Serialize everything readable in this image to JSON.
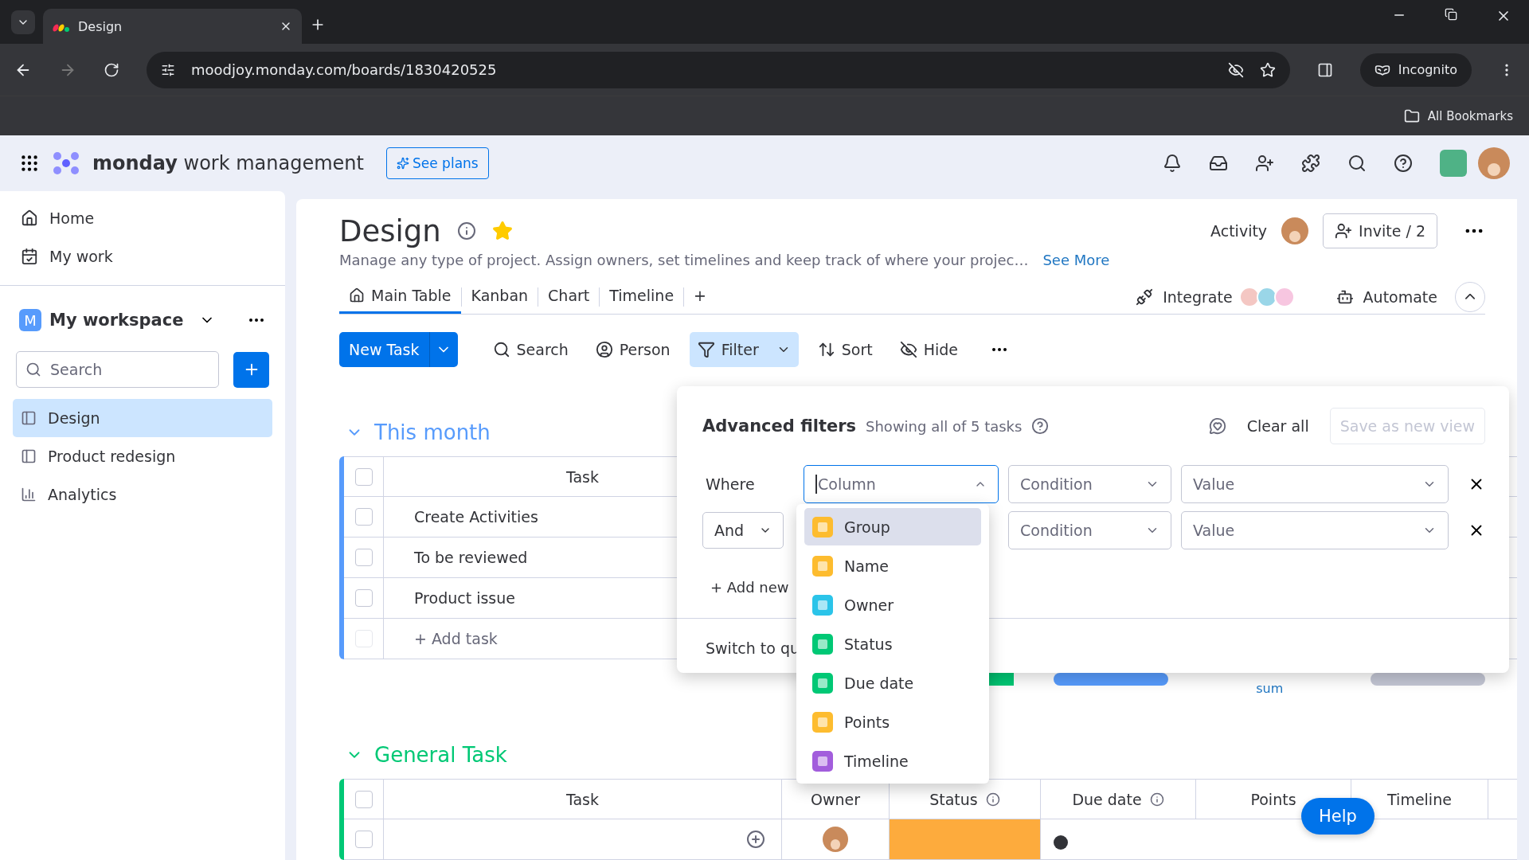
{
  "browser": {
    "tabs": [
      {
        "title": "Design",
        "selected": true
      }
    ],
    "url": "moodjoy.monday.com/boards/1830420525",
    "profile": "Incognito",
    "bookmarks_label": "All Bookmarks"
  },
  "app_header": {
    "brand": "monday",
    "product": "work management",
    "plans_button": "See plans"
  },
  "sidebar": {
    "nav": [
      {
        "label": "Home",
        "kind": "home"
      },
      {
        "label": "My work",
        "kind": "mywork"
      }
    ],
    "workspace": {
      "badge": "M",
      "name": "My workspace"
    },
    "search": {
      "placeholder": "Search"
    },
    "boards": [
      {
        "label": "Design",
        "kind": "board",
        "selected": true
      },
      {
        "label": "Product redesign",
        "kind": "board",
        "selected": false
      },
      {
        "label": "Analytics",
        "kind": "dashboard",
        "selected": false
      }
    ]
  },
  "board": {
    "title": "Design",
    "favorite": true,
    "description": "Manage any type of project. Assign owners, set timelines and keep track of where your projec…",
    "see_more": "See More",
    "activity": "Activity",
    "invite": "Invite / 2",
    "views": [
      {
        "label": "Main Table",
        "kind": "home",
        "selected": true
      },
      {
        "label": "Kanban",
        "kind": "plain",
        "selected": false
      },
      {
        "label": "Chart",
        "kind": "plain",
        "selected": false
      },
      {
        "label": "Timeline",
        "kind": "plain",
        "selected": false
      }
    ],
    "add_view": "+",
    "integrate": "Integrate",
    "automate": "Automate",
    "toolbar": {
      "new_task": "New Task",
      "items": [
        {
          "label": "Search",
          "kind": "search",
          "active": false
        },
        {
          "label": "Person",
          "kind": "person",
          "active": false
        },
        {
          "label": "Filter",
          "kind": "filter",
          "active": true
        },
        {
          "label": "Sort",
          "kind": "sort",
          "active": false
        },
        {
          "label": "Hide",
          "kind": "hide",
          "active": false
        }
      ]
    },
    "groups": [
      {
        "title": "This month",
        "color": "#579bfc",
        "all_checked": false,
        "columns": [
          "Task"
        ],
        "rows": [
          {
            "task": "Create Activities",
            "checked": false
          },
          {
            "task": "To be reviewed",
            "checked": false
          },
          {
            "task": "Product issue",
            "checked": false
          }
        ],
        "add_row": {
          "label": "+ Add task",
          "checked": false
        },
        "summary": "sum"
      },
      {
        "title": "General Task",
        "color": "#00c875",
        "all_checked": false,
        "columns": [
          "Task",
          "Owner",
          "Status",
          "Due date",
          "Points",
          "Timeline"
        ],
        "rows": [
          {
            "checked": false,
            "color": "#fdab3d"
          }
        ]
      }
    ]
  },
  "filter_panel": {
    "title": "Advanced filters",
    "summary": "Showing all of 5 tasks",
    "clear": "Clear all",
    "save": "Save as new view",
    "rules": [
      {
        "lead": "Where",
        "kind": "label",
        "column": "Column",
        "condition": "Condition",
        "value": "Value"
      },
      {
        "lead": "And",
        "kind": "select",
        "condition": "Condition",
        "value": "Value"
      }
    ],
    "add": "+ Add new",
    "switch": "Switch to qu",
    "column_menu": [
      {
        "label": "Group",
        "color": "#fdbc2f",
        "selected": true
      },
      {
        "label": "Name",
        "color": "#fdbc2f",
        "selected": false
      },
      {
        "label": "Owner",
        "color": "#2bc4e9",
        "selected": false
      },
      {
        "label": "Status",
        "color": "#00c875",
        "selected": false
      },
      {
        "label": "Due date",
        "color": "#00c875",
        "selected": false
      },
      {
        "label": "Points",
        "color": "#fdbc2f",
        "selected": false
      },
      {
        "label": "Timeline",
        "color": "#a25ddc",
        "selected": false
      }
    ]
  },
  "help": "Help"
}
